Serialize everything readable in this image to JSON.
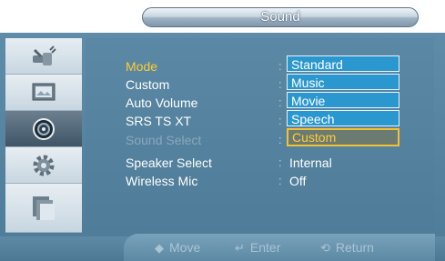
{
  "window": {
    "title": "Sound"
  },
  "sidebar": {
    "items": [
      {
        "name": "input",
        "icon": "plug-icon",
        "active": false
      },
      {
        "name": "picture",
        "icon": "picture-icon",
        "active": false
      },
      {
        "name": "sound",
        "icon": "speaker-icon",
        "active": true
      },
      {
        "name": "setup",
        "icon": "gear-icon",
        "active": false
      },
      {
        "name": "multi-control",
        "icon": "layers-icon",
        "active": false
      }
    ]
  },
  "menu": {
    "items": [
      {
        "label": "Mode",
        "state": "selected",
        "value": ""
      },
      {
        "label": "Custom",
        "state": "normal",
        "value": ""
      },
      {
        "label": "Auto Volume",
        "state": "normal",
        "value": ""
      },
      {
        "label": "SRS TS XT",
        "state": "normal",
        "value": ""
      },
      {
        "label": "Sound Select",
        "state": "disabled",
        "value": ""
      },
      {
        "label": "Speaker Select",
        "state": "normal",
        "value": "Internal"
      },
      {
        "label": "Wireless Mic",
        "state": "normal",
        "value": "Off"
      }
    ]
  },
  "dropdown": {
    "options": [
      "Standard",
      "Music",
      "Movie",
      "Speech",
      "Custom"
    ],
    "selected": "Custom"
  },
  "footer": {
    "move": "Move",
    "enter": "Enter",
    "return": "Return"
  },
  "colors": {
    "selected_text": "#ffcc33",
    "option_bg": "#2b97cf",
    "panel_bg": "#4f7d99"
  }
}
